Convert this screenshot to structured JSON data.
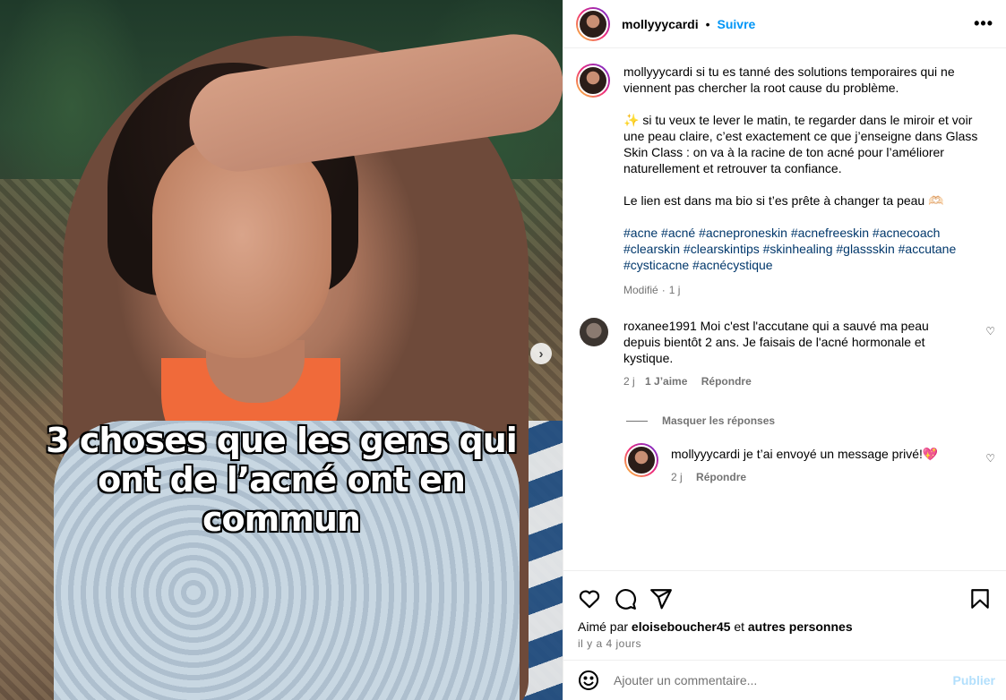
{
  "media": {
    "overlay_lines": [
      "3 choses que les gens qui",
      "ont de l’acné ont en",
      "commun"
    ],
    "next_icon": "chevron-right-icon"
  },
  "header": {
    "username": "mollyyycardi",
    "dot": "•",
    "follow_label": "Suivre",
    "more_icon": "more-horizontal-icon"
  },
  "caption": {
    "username": "mollyyycardi",
    "p1": " si tu es tanné des solutions temporaires qui ne viennent pas chercher la root cause du problème.",
    "p2": "✨ si tu veux te lever le matin, te regarder dans le miroir et voir une peau claire, c’est exactement ce que j’enseigne dans Glass Skin Class : on va à la racine de ton acné pour l’améliorer naturellement et retrouver ta confiance.",
    "p3": "Le lien est dans ma bio si t’es prête à changer ta peau 🫶🏻",
    "hashtags": [
      "#acne",
      "#acné",
      "#acneproneskin",
      "#acnefreeskin",
      "#acnecoach",
      "#clearskin",
      "#clearskintips",
      "#skinhealing",
      "#glassskin",
      "#accutane",
      "#cysticacne",
      "#acnécystique"
    ],
    "edited": "Modifié",
    "sep": "·",
    "age": "1 j"
  },
  "comments": [
    {
      "username": "roxanee1991",
      "text": " Moi c'est l'accutane qui a sauvé ma peau depuis bientôt 2 ans. Je faisais de l'acné hormonale et kystique.",
      "age": "2 j",
      "likes": "1 J’aime",
      "reply": "Répondre"
    }
  ],
  "replies_toggle": "Masquer les réponses",
  "reply": {
    "username": "mollyyycardi",
    "text": " je t’ai envoyé un message privé!💖",
    "age": "2 j",
    "reply": "Répondre"
  },
  "actions": {
    "like_icon": "heart-icon",
    "comment_icon": "comment-icon",
    "share_icon": "send-icon",
    "save_icon": "bookmark-icon",
    "liked_prefix": "Aimé par",
    "liked_user": "eloiseboucher45",
    "liked_and": "et",
    "liked_others": "autres personnes",
    "time": "il y a 4 jours"
  },
  "add_comment": {
    "emoji_icon": "smiley-icon",
    "placeholder": "Ajouter un commentaire...",
    "publish": "Publier"
  },
  "colors": {
    "link": "#0095f6",
    "hashtag": "#00376b",
    "muted": "#737373",
    "publish_disabled": "#b2dffc"
  }
}
